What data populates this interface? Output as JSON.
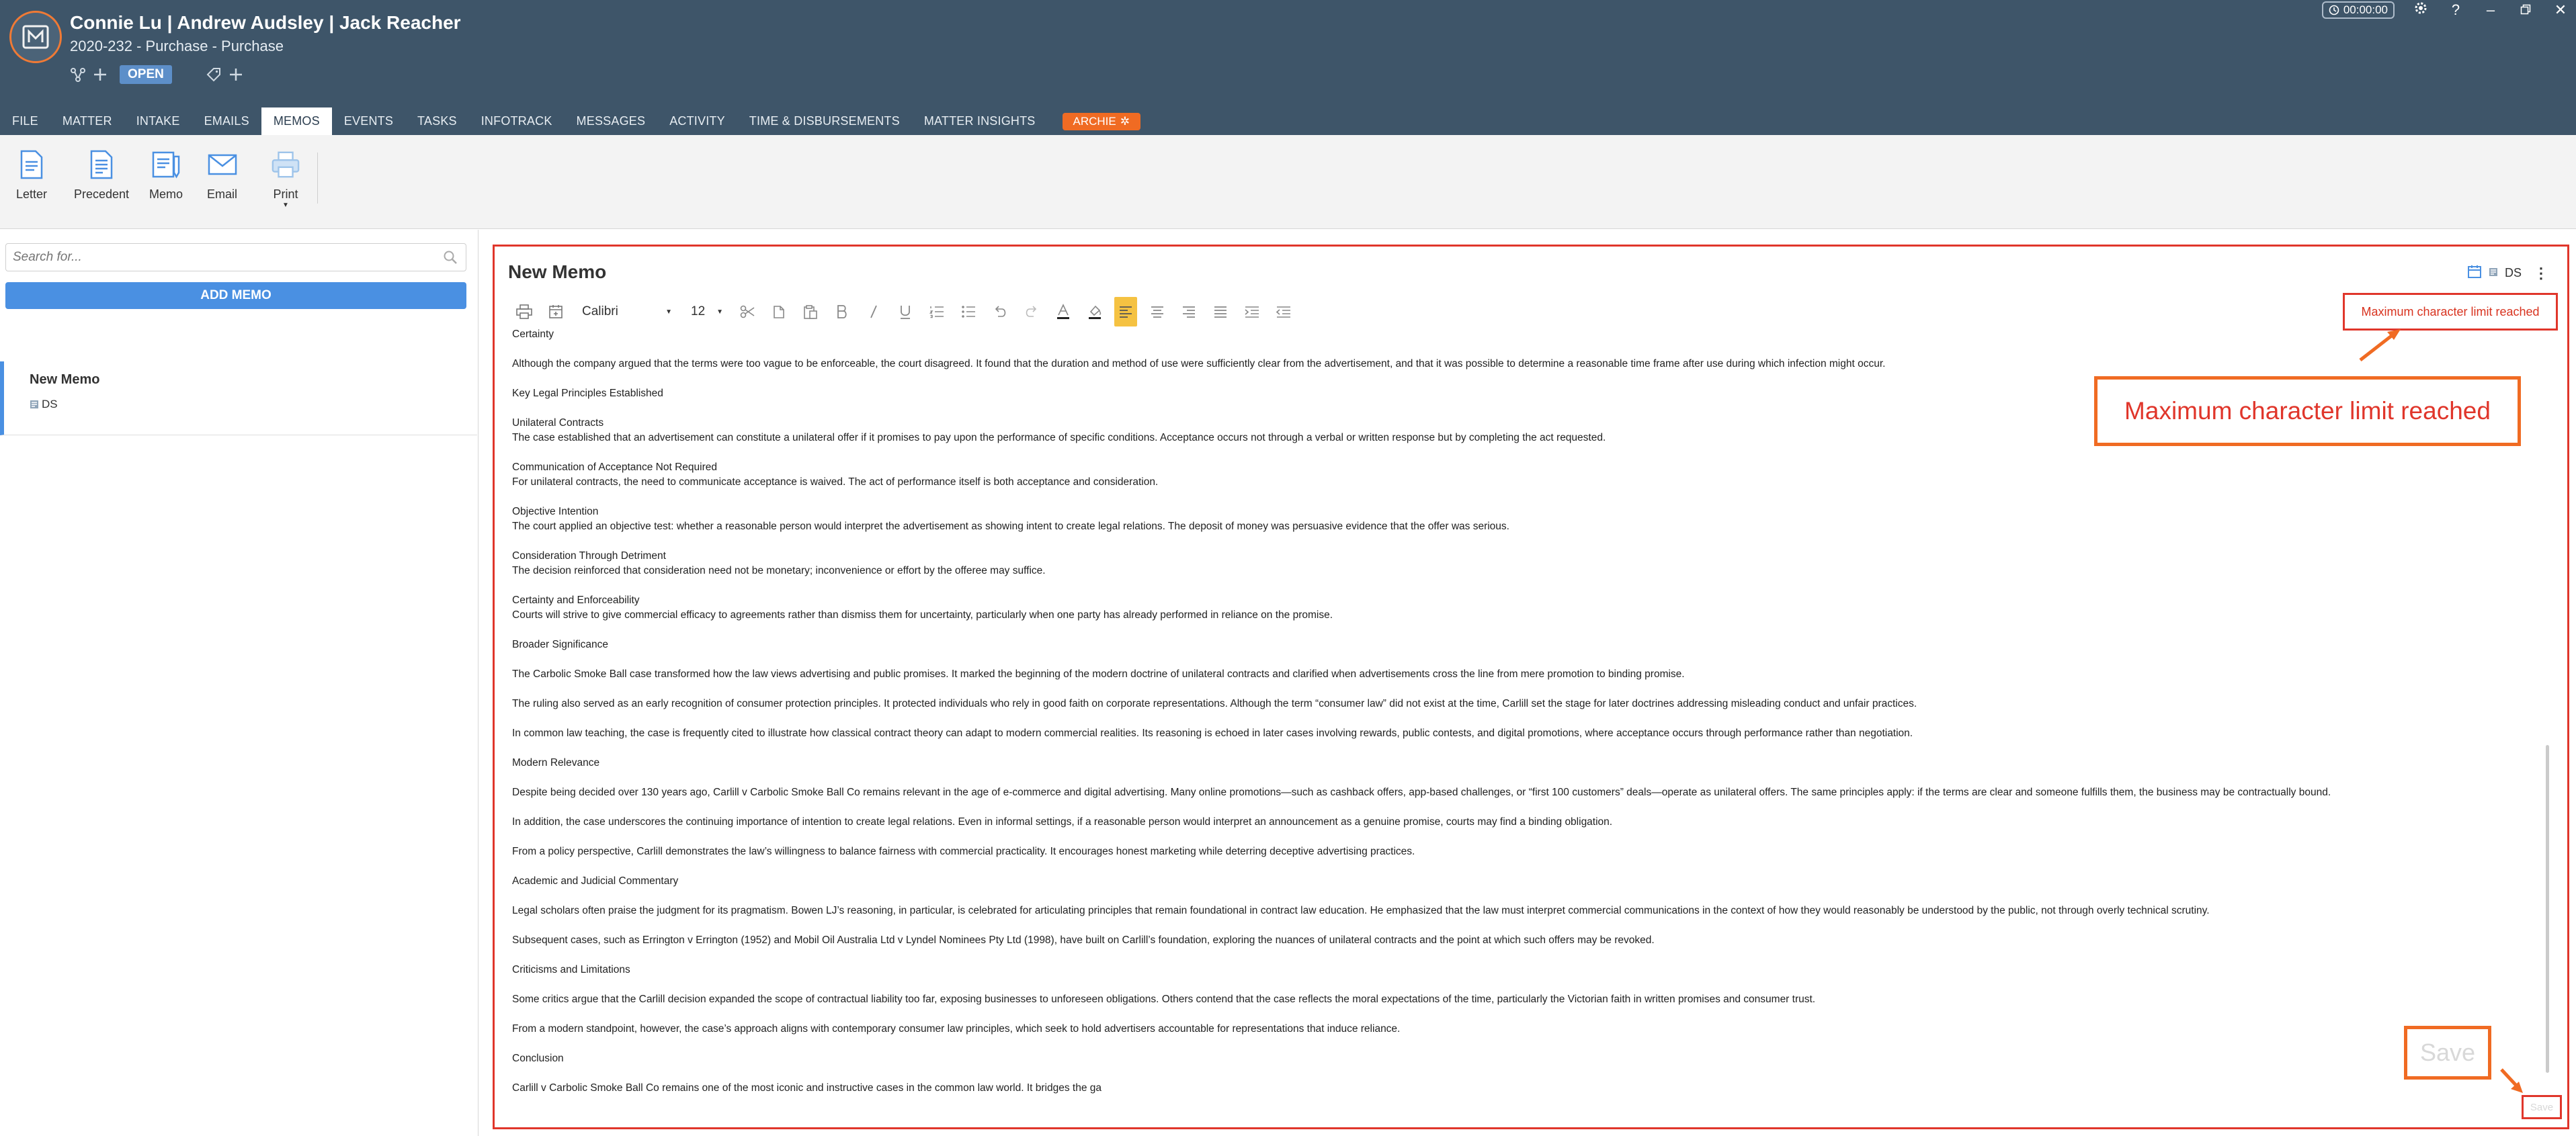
{
  "header": {
    "title": "Connie Lu | Andrew Audsley | Jack Reacher",
    "subtitle": "2020-232 - Purchase - Purchase",
    "status": "OPEN",
    "timer": "00:00:00"
  },
  "tabs": [
    {
      "label": "FILE",
      "active": false
    },
    {
      "label": "MATTER",
      "active": false
    },
    {
      "label": "INTAKE",
      "active": false
    },
    {
      "label": "EMAILS",
      "active": false
    },
    {
      "label": "MEMOS",
      "active": true
    },
    {
      "label": "EVENTS",
      "active": false
    },
    {
      "label": "TASKS",
      "active": false
    },
    {
      "label": "INFOTRACK",
      "active": false
    },
    {
      "label": "MESSAGES",
      "active": false
    },
    {
      "label": "ACTIVITY",
      "active": false
    },
    {
      "label": "TIME & DISBURSEMENTS",
      "active": false
    },
    {
      "label": "MATTER INSIGHTS",
      "active": false
    }
  ],
  "archie_label": "ARCHIE",
  "ribbon": {
    "letter": "Letter",
    "precedent": "Precedent",
    "memo": "Memo",
    "email": "Email",
    "print": "Print"
  },
  "sidebar": {
    "search_placeholder": "Search for...",
    "add_memo": "ADD MEMO",
    "memo_title": "New Memo",
    "memo_author": "DS"
  },
  "editor": {
    "title": "New Memo",
    "author": "DS",
    "font": "Calibri",
    "size": "12",
    "limit_message": "Maximum character limit reached",
    "save_label": "Save",
    "colors": {
      "accent": "#f06b23",
      "error": "#e0362b",
      "header": "#3e5569",
      "primary": "#4a90e2"
    }
  },
  "document": {
    "p1": "Certainty",
    "p2": "Although the company argued that the terms were too vague to be enforceable, the court disagreed. It found that the duration and method of use were sufficiently clear from the advertisement, and that it was possible to determine a reasonable time frame after use during which infection might occur.",
    "p3": "Key Legal Principles Established",
    "p4a": "Unilateral Contracts",
    "p4b": "The case established that an advertisement can constitute a unilateral offer if it promises to pay upon the performance of specific conditions. Acceptance occurs not through a verbal or written response but by completing the act requested.",
    "p5a": "Communication of Acceptance Not Required",
    "p5b": "For unilateral contracts, the need to communicate acceptance is waived. The act of performance itself is both acceptance and consideration.",
    "p6a": "Objective Intention",
    "p6b": "The court applied an objective test: whether a reasonable person would interpret the advertisement as showing intent to create legal relations. The deposit of money was persuasive evidence that the offer was serious.",
    "p7a": "Consideration Through Detriment",
    "p7b": "The decision reinforced that consideration need not be monetary; inconvenience or effort by the offeree may suffice.",
    "p8a": "Certainty and Enforceability",
    "p8b": "Courts will strive to give commercial efficacy to agreements rather than dismiss them for uncertainty, particularly when one party has already performed in reliance on the promise.",
    "p9": "Broader Significance",
    "p10": "The Carbolic Smoke Ball case transformed how the law views advertising and public promises. It marked the beginning of the modern doctrine of unilateral contracts and clarified when advertisements cross the line from mere promotion to binding promise.",
    "p11": "The ruling also served as an early recognition of consumer protection principles. It protected individuals who rely in good faith on corporate representations. Although the term “consumer law” did not exist at the time, Carlill set the stage for later doctrines addressing misleading conduct and unfair practices.",
    "p12": "In common law teaching, the case is frequently cited to illustrate how classical contract theory can adapt to modern commercial realities. Its reasoning is echoed in later cases involving rewards, public contests, and digital promotions, where acceptance occurs through performance rather than negotiation.",
    "p13": "Modern Relevance",
    "p14": "Despite being decided over 130 years ago, Carlill v Carbolic Smoke Ball Co remains relevant in the age of e-commerce and digital advertising. Many online promotions—such as cashback offers, app-based challenges, or “first 100 customers” deals—operate as unilateral offers. The same principles apply: if the terms are clear and someone fulfills them, the business may be contractually bound.",
    "p15": "In addition, the case underscores the continuing importance of intention to create legal relations. Even in informal settings, if a reasonable person would interpret an announcement as a genuine promise, courts may find a binding obligation.",
    "p16": "From a policy perspective, Carlill demonstrates the law’s willingness to balance fairness with commercial practicality. It encourages honest marketing while deterring deceptive advertising practices.",
    "p17": "Academic and Judicial Commentary",
    "p18": "Legal scholars often praise the judgment for its pragmatism. Bowen LJ’s reasoning, in particular, is celebrated for articulating principles that remain foundational in contract law education. He emphasized that the law must interpret commercial communications in the context of how they would reasonably be understood by the public, not through overly technical scrutiny.",
    "p19": "Subsequent cases, such as Errington v Errington (1952) and Mobil Oil Australia Ltd v Lyndel Nominees Pty Ltd (1998), have built on Carlill’s foundation, exploring the nuances of unilateral contracts and the point at which such offers may be revoked.",
    "p20": "Criticisms and Limitations",
    "p21": "Some critics argue that the Carlill decision expanded the scope of contractual liability too far, exposing businesses to unforeseen obligations. Others contend that the case reflects the moral expectations of the time, particularly the Victorian faith in written promises and consumer trust.",
    "p22": "From a modern standpoint, however, the case’s approach aligns with contemporary consumer law principles, which seek to hold advertisers accountable for representations that induce reliance.",
    "p23": "Conclusion",
    "p24": "Carlill v Carbolic Smoke Ball Co remains one of the most iconic and instructive cases in the common law world. It bridges the ga"
  }
}
